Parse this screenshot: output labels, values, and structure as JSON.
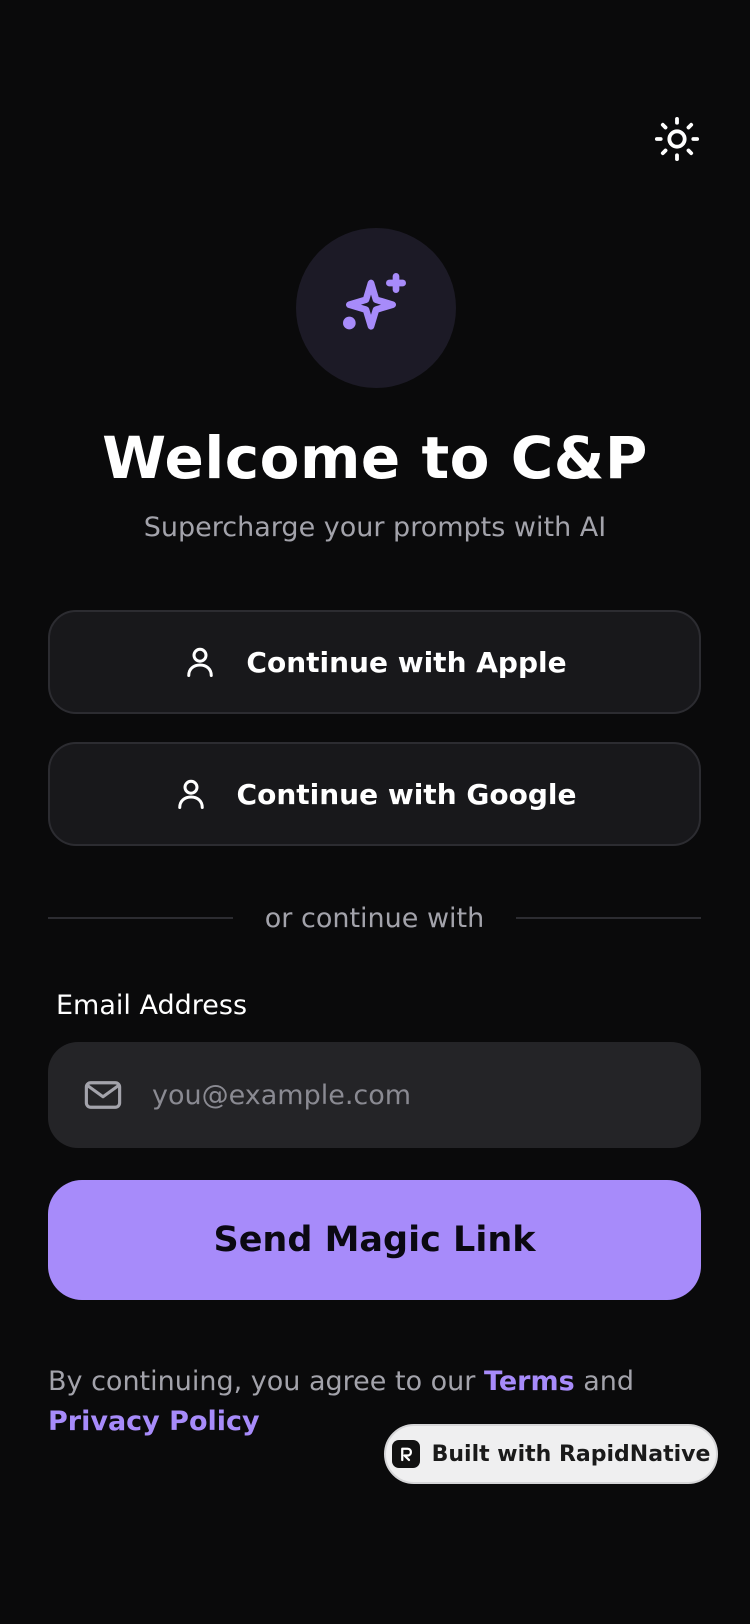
{
  "header": {
    "theme_toggle_icon": "sun-icon"
  },
  "logo": {
    "icon": "sparkles-icon",
    "accent_color": "#a78bfa"
  },
  "title": "Welcome to C&P",
  "subtitle": "Supercharge your prompts with AI",
  "social": {
    "apple_label": "Continue with Apple",
    "apple_icon": "user-icon",
    "google_label": "Continue with Google",
    "google_icon": "user-icon"
  },
  "divider_text": "or continue with",
  "email": {
    "label": "Email Address",
    "placeholder": "you@example.com",
    "value": "",
    "icon": "mail-icon"
  },
  "submit_label": "Send Magic Link",
  "legal": {
    "prefix": "By continuing, you agree to our ",
    "terms": "Terms",
    "middle": " and",
    "privacy": "Privacy Policy"
  },
  "badge": {
    "label": "Built with RapidNative",
    "icon": "rapidnative-logo-icon"
  },
  "colors": {
    "background": "#0a0a0b",
    "accent": "#a78bfa",
    "card": "#18181b",
    "input": "#242427",
    "muted_text": "#a3a3ab"
  }
}
